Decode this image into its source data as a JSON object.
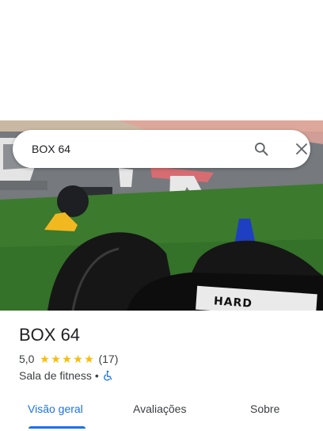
{
  "search": {
    "value": "BOX 64",
    "search_icon": "search-icon",
    "close_icon": "close-icon"
  },
  "hero": {
    "bag_text": "HARD"
  },
  "place": {
    "title": "BOX 64",
    "rating": "5,0",
    "stars": 5,
    "review_count": "(17)",
    "category": "Sala de fitness",
    "separator": "•",
    "accessibility_icon": "wheelchair-icon"
  },
  "tabs": [
    {
      "label": "Visão geral",
      "active": true
    },
    {
      "label": "Avaliações",
      "active": false
    },
    {
      "label": "Sobre",
      "active": false
    }
  ],
  "colors": {
    "accent": "#1a73e8",
    "star": "#fbbc04",
    "text": "#202124"
  }
}
